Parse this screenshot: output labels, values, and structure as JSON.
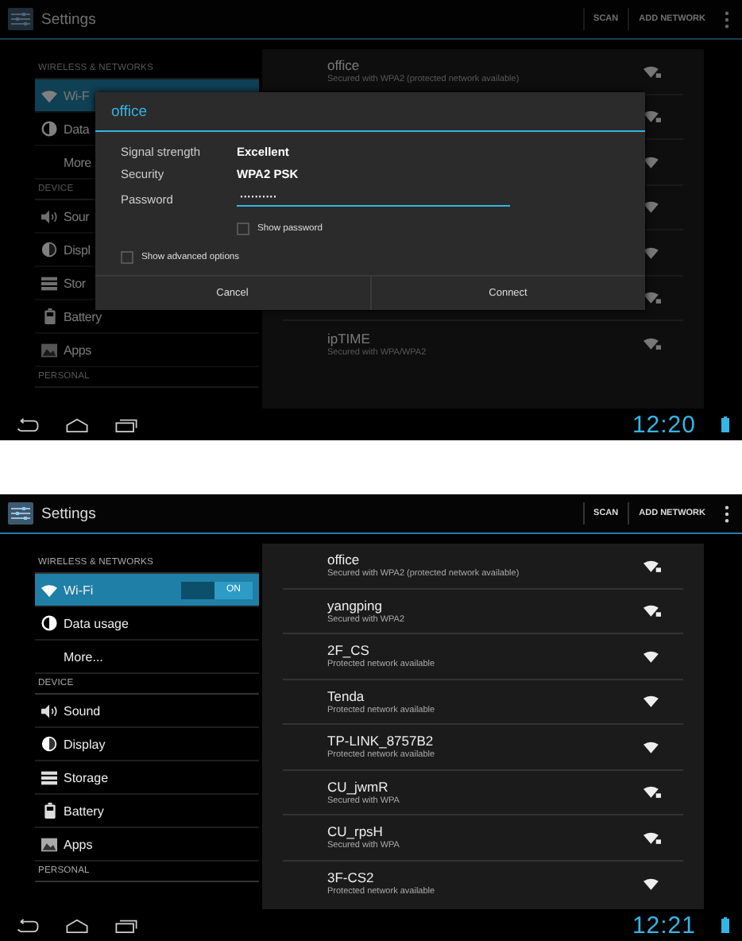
{
  "screens": [
    {
      "action_bar": {
        "title": "Settings",
        "actions": [
          "SCAN",
          "ADD NETWORK"
        ]
      },
      "sidebar": [
        {
          "header": "WIRELESS & NETWORKS",
          "items": [
            {
              "label": "Wi-F",
              "kind": "wifi",
              "selected": true
            },
            {
              "label": "Data",
              "kind": "data",
              "selected": false
            },
            {
              "label": "More",
              "kind": "plain",
              "selected": false
            }
          ]
        },
        {
          "header": "DEVICE",
          "items": [
            {
              "label": "Sour",
              "kind": "sound",
              "selected": false
            },
            {
              "label": "Displ",
              "kind": "display",
              "selected": false
            },
            {
              "label": "Stor",
              "kind": "storage",
              "selected": false
            },
            {
              "label": "Battery",
              "kind": "battery",
              "selected": false
            },
            {
              "label": "Apps",
              "kind": "apps",
              "selected": false
            }
          ]
        },
        {
          "header": "PERSONAL"
        }
      ],
      "networks": [
        {
          "name": "office",
          "detail": "Secured with WPA2 (protected network available)",
          "secured": true
        },
        {
          "secured": true
        },
        {
          "secured": false
        },
        {
          "secured": false
        },
        {
          "secured": false
        },
        {
          "secured": true
        },
        {
          "name": "ipTIME",
          "detail": "Secured with WPA/WPA2",
          "secured": true
        }
      ],
      "dialog": {
        "title": "office",
        "rows": [
          {
            "label": "Signal strength",
            "value": "Excellent"
          },
          {
            "label": "Security",
            "value": "WPA2 PSK"
          }
        ],
        "password": {
          "label": "Password",
          "value": "··········"
        },
        "show_password": {
          "label": "Show password",
          "checked": false
        },
        "advanced": {
          "label": "Show advanced options",
          "checked": false
        },
        "buttons": [
          "Cancel",
          "Connect"
        ]
      },
      "clock": "12:20"
    },
    {
      "action_bar": {
        "title": "Settings",
        "actions": [
          "SCAN",
          "ADD NETWORK"
        ]
      },
      "sidebar": [
        {
          "header": "WIRELESS & NETWORKS",
          "items": [
            {
              "label": "Wi-Fi",
              "kind": "wifi",
              "selected": true,
              "switch": {
                "label": "ON",
                "on": true
              }
            },
            {
              "label": "Data usage",
              "kind": "data",
              "selected": false
            },
            {
              "label": "More...",
              "kind": "plain",
              "selected": false
            }
          ]
        },
        {
          "header": "DEVICE",
          "items": [
            {
              "label": "Sound",
              "kind": "sound",
              "selected": false
            },
            {
              "label": "Display",
              "kind": "display",
              "selected": false
            },
            {
              "label": "Storage",
              "kind": "storage",
              "selected": false
            },
            {
              "label": "Battery",
              "kind": "battery",
              "selected": false
            },
            {
              "label": "Apps",
              "kind": "apps",
              "selected": false
            }
          ]
        },
        {
          "header": "PERSONAL"
        }
      ],
      "networks": [
        {
          "name": "office",
          "detail": "Secured with WPA2 (protected network available)",
          "secured": true
        },
        {
          "name": "yangping",
          "detail": "Secured with WPA2",
          "secured": true
        },
        {
          "name": "2F_CS",
          "detail": "Protected network available",
          "secured": false
        },
        {
          "name": "Tenda",
          "detail": "Protected network available",
          "secured": false
        },
        {
          "name": "TP-LINK_8757B2",
          "detail": "Protected network available",
          "secured": false
        },
        {
          "name": "CU_jwmR",
          "detail": "Secured with WPA",
          "secured": true
        },
        {
          "name": "CU_rpsH",
          "detail": "Secured with WPA",
          "secured": true
        },
        {
          "name": "3F-CS2",
          "detail": "Protected network available",
          "secured": false
        }
      ],
      "clock": "12:21"
    }
  ]
}
